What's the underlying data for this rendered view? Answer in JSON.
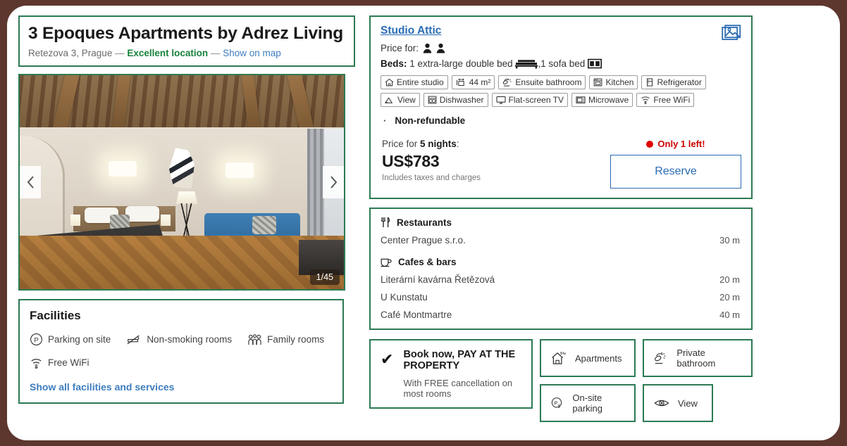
{
  "theme": {
    "page_background": "#5d372e",
    "panel_border_green": "#2c7a53",
    "link_blue": "#3d7dbf",
    "room_link_blue": "#2a6bb3",
    "excellent_green": "#17823b",
    "alert_red": "#cc0000"
  },
  "header": {
    "title": "3 Epoques Apartments by Adrez Living",
    "address": "Retezova 3, Prague",
    "dash1": "—",
    "location_rating": "Excellent location",
    "dash2": "—",
    "show_on_map": "Show on map"
  },
  "gallery": {
    "prev_label": "‹",
    "next_label": "›",
    "counter": "1/45"
  },
  "facilities": {
    "title": "Facilities",
    "items": [
      {
        "icon": "parking-icon",
        "label": "Parking on site"
      },
      {
        "icon": "no-smoking-icon",
        "label": "Non-smoking rooms"
      },
      {
        "icon": "family-rooms-icon",
        "label": "Family rooms"
      },
      {
        "icon": "wifi-icon",
        "label": "Free WiFi"
      }
    ],
    "show_all_link": "Show all facilities and services"
  },
  "room": {
    "name": "Studio Attic",
    "price_for_label": "Price for:",
    "occupancy_count": 2,
    "beds_label": "Beds:",
    "bed_primary": "1 extra-large double bed",
    "bed_separator": ", ",
    "bed_secondary": "1 sofa bed",
    "amenities": [
      {
        "icon": "home-icon",
        "label": "Entire studio"
      },
      {
        "icon": "area-icon",
        "label": "44 m²"
      },
      {
        "icon": "shower-icon",
        "label": "Ensuite bathroom"
      },
      {
        "icon": "kitchen-icon",
        "label": "Kitchen"
      },
      {
        "icon": "refrigerator-icon",
        "label": "Refrigerator"
      },
      {
        "icon": "view-icon",
        "label": "View"
      },
      {
        "icon": "dishwasher-icon",
        "label": "Dishwasher"
      },
      {
        "icon": "tv-icon",
        "label": "Flat-screen TV"
      },
      {
        "icon": "microwave-icon",
        "label": "Microwave"
      },
      {
        "icon": "wifi-icon",
        "label": "Free WiFi"
      }
    ],
    "policy_bullet": "·",
    "policy": "Non-refundable",
    "price_prefix": "Price for",
    "price_nights": "5 nights",
    "price_suffix": ":",
    "price_amount": "US$783",
    "price_note": "Includes taxes and charges",
    "availability_warning": "Only 1 left!",
    "reserve_label": "Reserve"
  },
  "nearby": {
    "restaurants_title": "Restaurants",
    "restaurants": [
      {
        "name": "Center Prague s.r.o.",
        "distance": "30 m"
      }
    ],
    "cafes_title": "Cafes & bars",
    "cafes": [
      {
        "name": "Literární kavárna Řetězová",
        "distance": "20 m"
      },
      {
        "name": "U Kunstatu",
        "distance": "20 m"
      },
      {
        "name": "Café Montmartre",
        "distance": "40 m"
      }
    ]
  },
  "book_now": {
    "check": "✔",
    "title": "Book now, PAY AT THE PROPERTY",
    "subtitle": "With FREE cancellation on most rooms"
  },
  "property_tiles": [
    {
      "icon": "apartments-icon",
      "label": "Apartments"
    },
    {
      "icon": "private-bathroom-icon",
      "label": "Private bathroom"
    },
    {
      "icon": "onsite-parking-icon",
      "label": "On-site parking"
    },
    {
      "icon": "eye-view-icon",
      "label": "View"
    }
  ]
}
